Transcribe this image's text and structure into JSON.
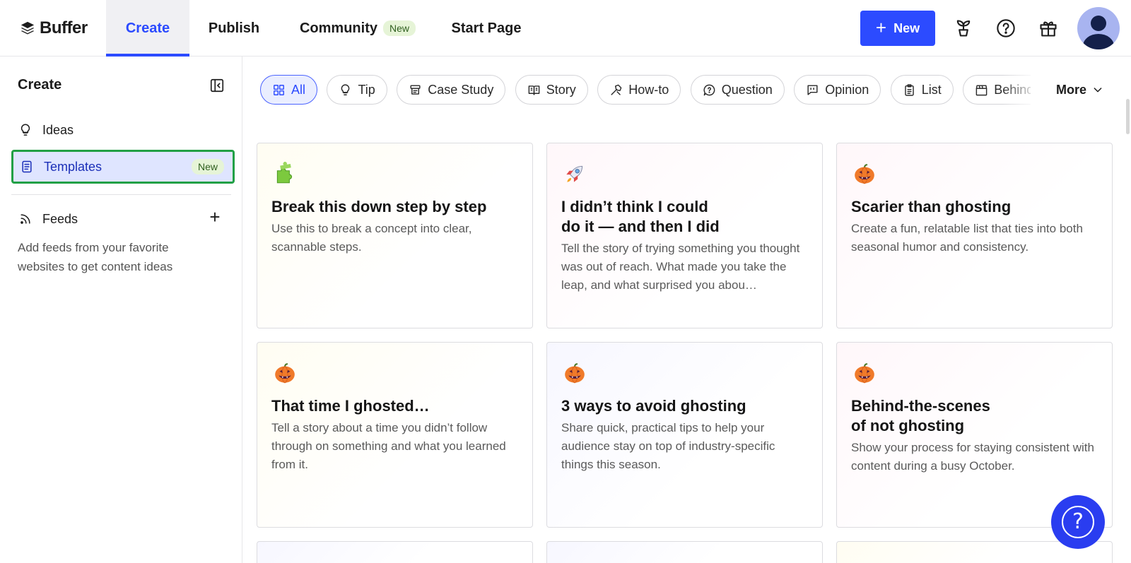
{
  "app": {
    "logo_text": "Buffer"
  },
  "nav": {
    "tabs": [
      {
        "label": "Create",
        "active": true
      },
      {
        "label": "Publish",
        "active": false
      },
      {
        "label": "Community",
        "badge": "New",
        "active": false
      },
      {
        "label": "Start Page",
        "active": false
      }
    ],
    "new_button_label": "New",
    "icons": [
      "plant-icon",
      "help-icon",
      "gift-icon",
      "avatar"
    ],
    "accent_color": "#2c4bff"
  },
  "sidebar": {
    "title": "Create",
    "items": [
      {
        "label": "Ideas",
        "icon": "lightbulb-icon"
      },
      {
        "label": "Templates",
        "icon": "document-icon",
        "badge": "New",
        "selected": true
      },
      {
        "label": "Feeds",
        "icon": "rss-icon"
      }
    ],
    "feeds_add": "+",
    "feeds_description": "Add feeds from your favorite websites to get content ideas"
  },
  "filters": {
    "chips": [
      {
        "label": "All",
        "icon": "grid-icon",
        "active": true
      },
      {
        "label": "Tip",
        "icon": "lightbulb-icon"
      },
      {
        "label": "Case Study",
        "icon": "case-study-icon"
      },
      {
        "label": "Story",
        "icon": "book-icon"
      },
      {
        "label": "How-to",
        "icon": "tools-icon"
      },
      {
        "label": "Question",
        "icon": "question-bubble-icon"
      },
      {
        "label": "Opinion",
        "icon": "quote-bubble-icon"
      },
      {
        "label": "List",
        "icon": "clipboard-icon"
      },
      {
        "label": "Behind the Scenes",
        "icon": "clapperboard-icon"
      }
    ],
    "more_label": "More"
  },
  "templates": [
    {
      "emoji": "puzzle",
      "title": "Break this down step by step",
      "description": "Use this to break a concept into clear, scannable steps."
    },
    {
      "emoji": "rocket",
      "title": "I didn’t think I could\ndo it — and then I did",
      "description": "Tell the story of trying something you thought was out of reach. What made you take the leap, and what surprised you abou…"
    },
    {
      "emoji": "pumpkin",
      "title": "Scarier than ghosting",
      "description": "Create a fun, relatable list that ties into both seasonal humor and consistency."
    },
    {
      "emoji": "pumpkin",
      "title": "That time I ghosted…",
      "description": "Tell a story about a time you didn’t follow through on something and what you learned from it."
    },
    {
      "emoji": "pumpkin",
      "title": "3 ways to avoid ghosting",
      "description": "Share quick, practical tips to help your audience stay on top of industry-specific things this season."
    },
    {
      "emoji": "pumpkin",
      "title": "Behind-the-scenes\nof not ghosting",
      "description": "Show your process for staying consistent with content during a busy October."
    }
  ],
  "help_button": "?"
}
